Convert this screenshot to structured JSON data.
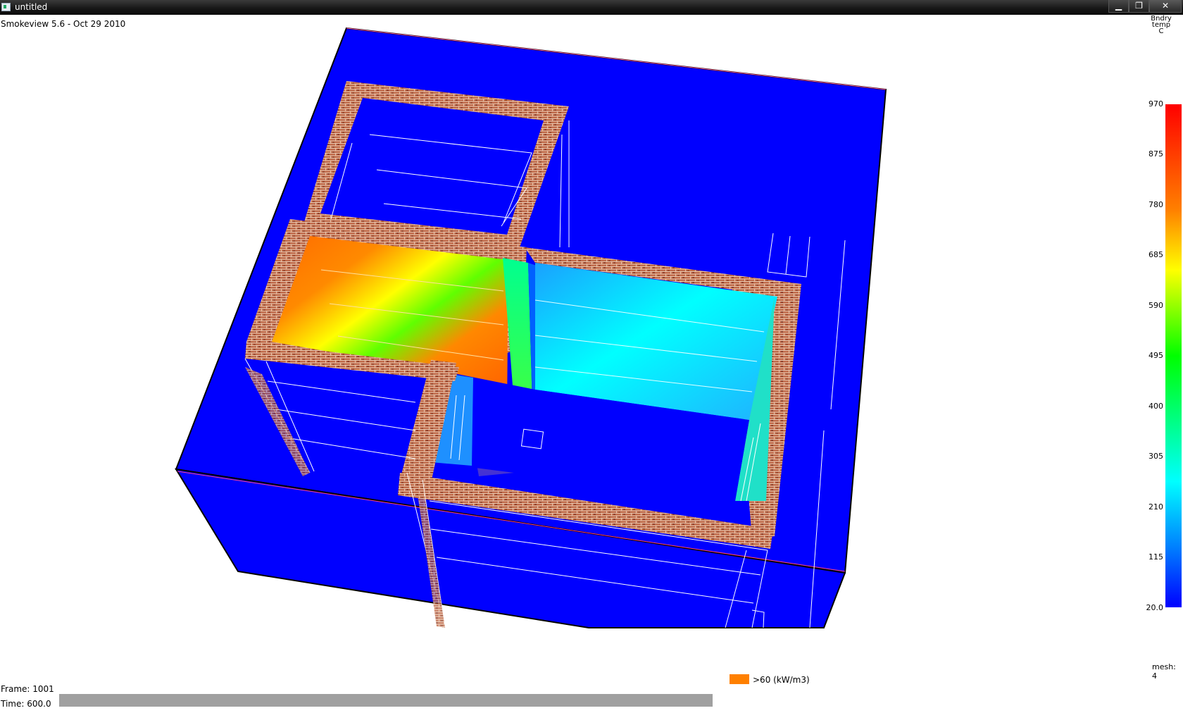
{
  "window": {
    "title": "untitled",
    "minimize": "▁",
    "restore": "❐",
    "close": "✕"
  },
  "app": {
    "version": "Smokeview 5.6 - Oct 29 2010"
  },
  "colorbar": {
    "title_lines": [
      "Bndry",
      "temp",
      "C"
    ],
    "labels": [
      "970",
      "875",
      "780",
      "685",
      "590",
      "495",
      "400",
      "305",
      "210",
      "115",
      "20.0"
    ],
    "colors": [
      "#ff0000",
      "#ff8000",
      "#ffff00",
      "#00ff00",
      "#00ffff",
      "#0080ff",
      "#0000ff"
    ]
  },
  "status": {
    "mesh": "mesh: 4",
    "hrr_label": ">60 (kW/m3)",
    "hrr_color": "#ff8000",
    "frame": "Frame: 1001",
    "time": "Time: 600.0"
  },
  "scene": {
    "background": "#ffffff",
    "building_color": "#0000ff",
    "brick_color": "#b5553a"
  }
}
